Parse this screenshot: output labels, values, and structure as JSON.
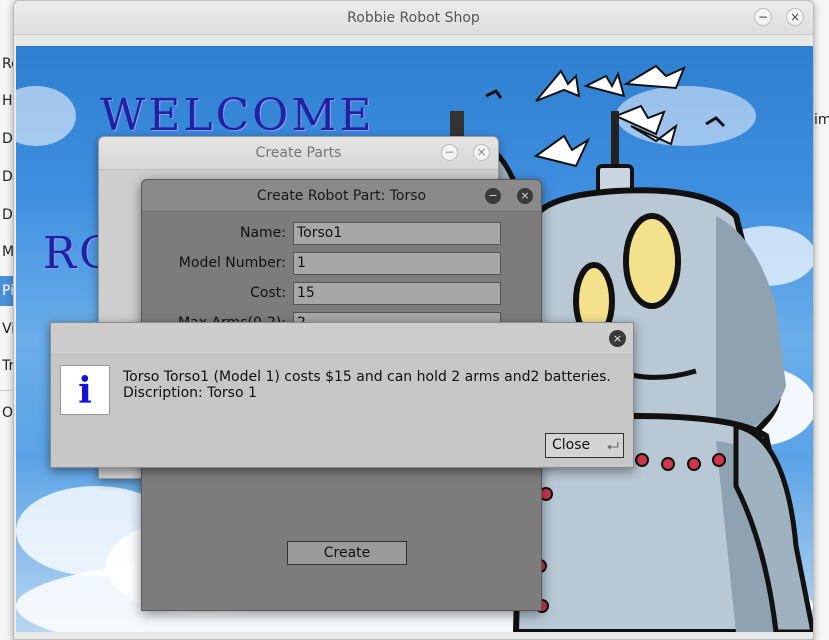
{
  "background_app": {
    "list_items": [
      "Re",
      "H",
      "D",
      "D",
      "D",
      "M",
      "Pi",
      "Vi",
      "Tr",
      "O"
    ],
    "selected_index": 6,
    "right_text": "im"
  },
  "main_window": {
    "title": "Robbie Robot Shop",
    "minimize_label": "−",
    "close_label": "×",
    "welcome_text": "WELCOME",
    "welcome_partial": "RO"
  },
  "parts_dialog": {
    "title": "Create Parts",
    "minimize_label": "−",
    "close_label": "×"
  },
  "torso_dialog": {
    "title": "Create Robot Part: Torso",
    "minimize_label": "−",
    "close_label": "×",
    "fields": [
      {
        "label": "Name:",
        "value": "Torso1"
      },
      {
        "label": "Model Number:",
        "value": "1"
      },
      {
        "label": "Cost:",
        "value": "15"
      },
      {
        "label": "Max Arms(0-2):",
        "value": "2"
      }
    ],
    "create_label": "Create"
  },
  "message_dialog": {
    "close_x": "×",
    "icon_letter": "i",
    "line1": "Torso Torso1 (Model 1) costs $15 and can hold 2 arms and2 batteries.",
    "line2": "Discription: Torso 1",
    "close_label": "Close",
    "close_glyph": "⮠"
  },
  "colors": {
    "welcome_text": "#2222a0",
    "info_icon": "#1212d8",
    "selected_item": "#4a90d9"
  }
}
